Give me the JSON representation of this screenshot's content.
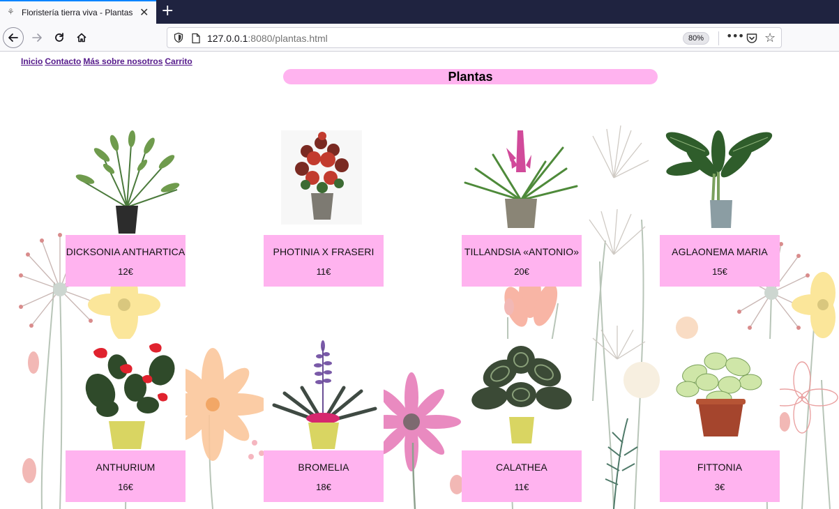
{
  "browser": {
    "tab_title": "Floristería tierra viva - Plantas",
    "url_host": "127.0.0.1",
    "url_rest": ":8080/plantas.html",
    "zoom": "80%"
  },
  "nav": {
    "inicio": "Inicio",
    "contacto": "Contacto",
    "nosotros": "Más sobre nosotros",
    "carrito": "Carrito"
  },
  "page": {
    "title": "Plantas"
  },
  "products": [
    {
      "name": "DICKSONIA ANTHARTICA",
      "price": "12€"
    },
    {
      "name": "PHOTINIA X FRASERI",
      "price": "11€"
    },
    {
      "name": "TILLANDSIA «ANTONIO»",
      "price": "20€"
    },
    {
      "name": "AGLAONEMA MARIA",
      "price": "15€"
    },
    {
      "name": "ANTHURIUM",
      "price": "16€"
    },
    {
      "name": "BROMELIA",
      "price": "18€"
    },
    {
      "name": "CALATHEA",
      "price": "11€"
    },
    {
      "name": "FITTONIA",
      "price": "3€"
    }
  ],
  "colors": {
    "card_bg": "#ffb3ef",
    "link": "#551a8b",
    "tabbar": "#1f2340"
  }
}
